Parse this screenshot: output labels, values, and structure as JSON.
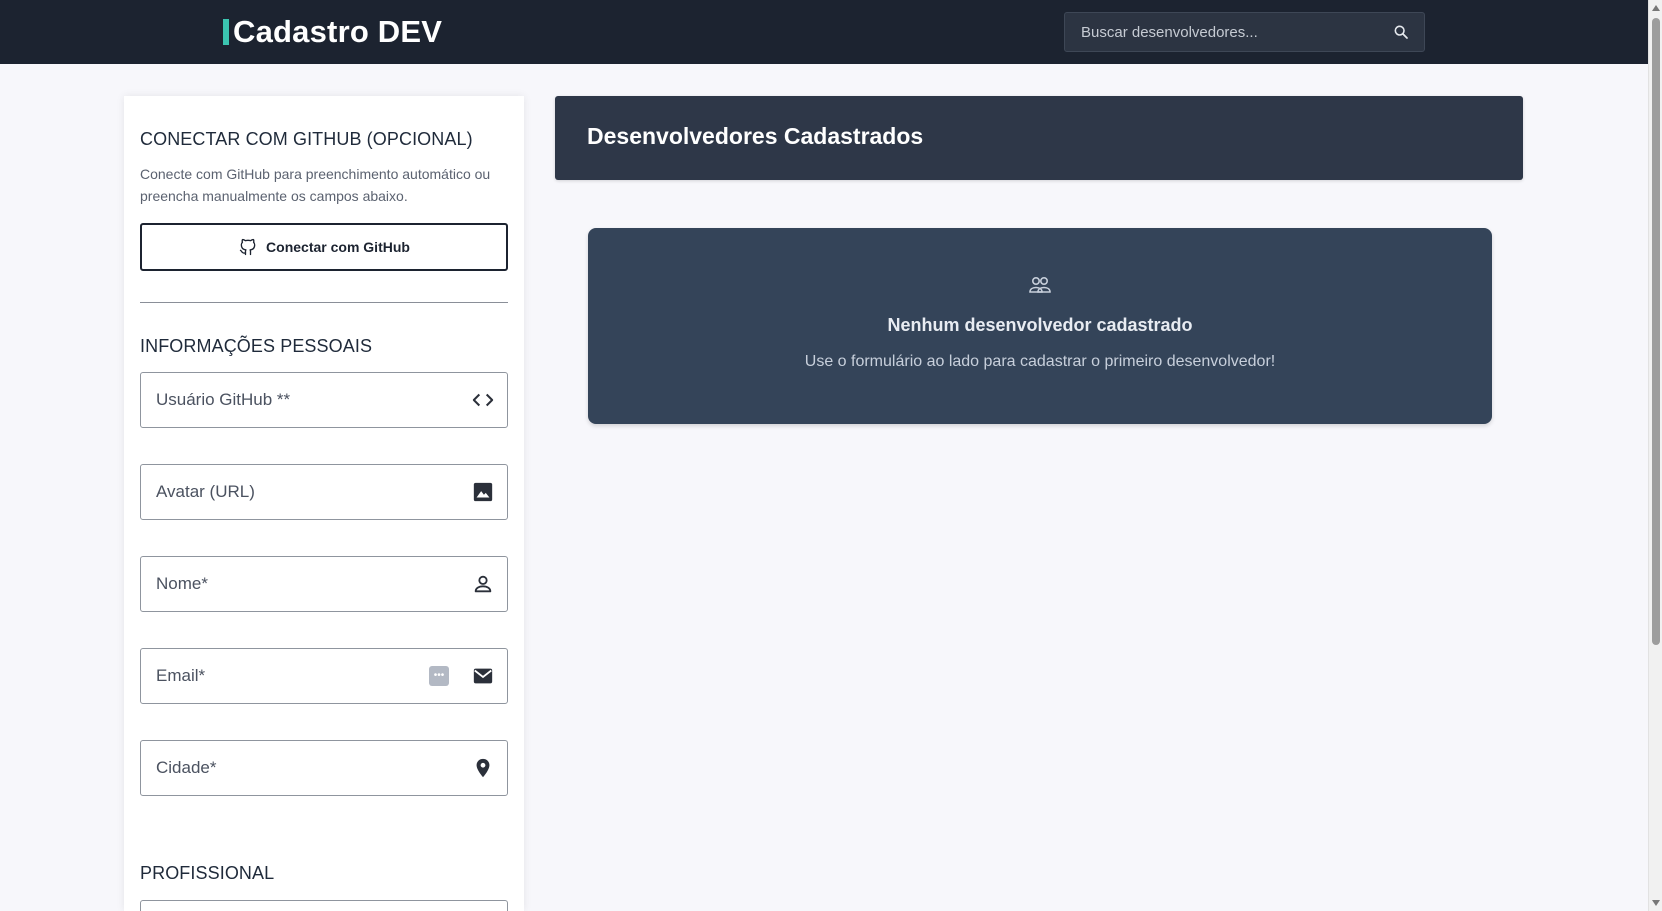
{
  "header": {
    "brand": "Cadastro DEV",
    "search_placeholder": "Buscar desenvolvedores..."
  },
  "form": {
    "github_section": {
      "title": "CONECTAR COM GITHUB (OPCIONAL)",
      "description": "Conecte com GitHub para preenchimento automático ou preencha manualmente os campos abaixo.",
      "button_label": "Conectar com GitHub"
    },
    "personal_section": {
      "title": "INFORMAÇÕES PESSOAIS",
      "fields": {
        "github_user": {
          "placeholder": "Usuário GitHub **",
          "icon": "code-icon"
        },
        "avatar": {
          "placeholder": "Avatar (URL)",
          "icon": "image-icon"
        },
        "name": {
          "placeholder": "Nome*",
          "icon": "person-icon"
        },
        "email": {
          "placeholder": "Email*",
          "icon": "mail-icon"
        },
        "city": {
          "placeholder": "Cidade*",
          "icon": "location-icon"
        }
      }
    },
    "professional_section": {
      "title": "PROFISSIONAL"
    }
  },
  "list": {
    "title": "Desenvolvedores Cadastrados",
    "empty_state": {
      "icon": "group-icon",
      "title": "Nenhum desenvolvedor cadastrado",
      "description": "Use o formulário ao lado para cadastrar o primeiro desenvolvedor!"
    }
  },
  "colors": {
    "header_bg": "#1c2330",
    "accent": "#3bc4b0",
    "card_bg": "#344459",
    "list_header_bg": "#2e3748"
  }
}
